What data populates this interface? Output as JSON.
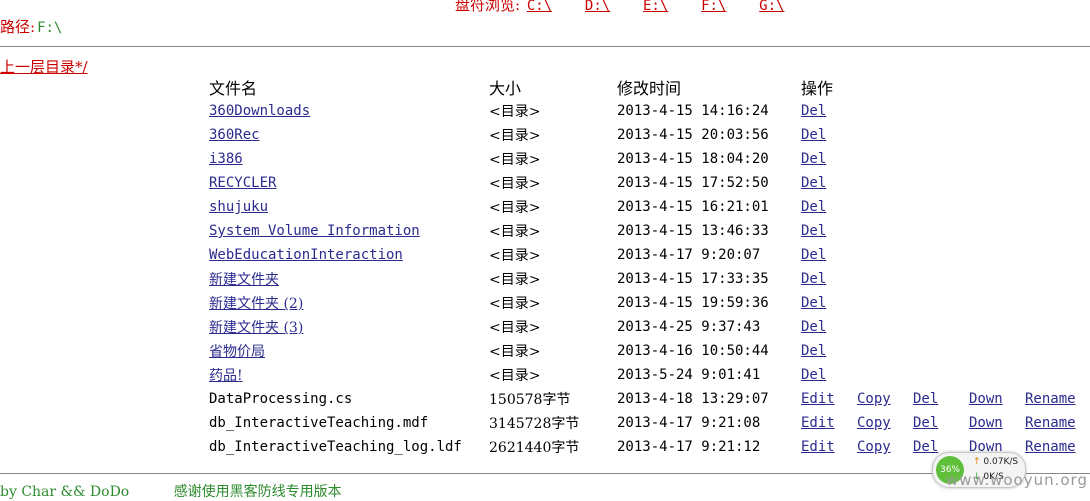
{
  "drives": {
    "label": "盘符浏览:",
    "items": [
      "C:\\",
      "D:\\",
      "E:\\",
      "F:\\",
      "G:\\"
    ]
  },
  "path": {
    "label": "路径:",
    "value": "F:\\"
  },
  "updir": {
    "label": "上一层目录*/"
  },
  "table": {
    "headers": {
      "name": "文件名",
      "size": "大小",
      "time": "修改时间",
      "op": "操作"
    },
    "dirs": [
      {
        "name": "360Downloads",
        "size": "<目录>",
        "time": "2013-4-15 14:16:24",
        "del": "Del"
      },
      {
        "name": "360Rec",
        "size": "<目录>",
        "time": "2013-4-15 20:03:56",
        "del": "Del"
      },
      {
        "name": "i386",
        "size": "<目录>",
        "time": "2013-4-15 18:04:20",
        "del": "Del"
      },
      {
        "name": "RECYCLER",
        "size": "<目录>",
        "time": "2013-4-15 17:52:50",
        "del": "Del"
      },
      {
        "name": "shujuku",
        "size": "<目录>",
        "time": "2013-4-15 16:21:01",
        "del": "Del"
      },
      {
        "name": "System Volume Information",
        "size": "<目录>",
        "time": "2013-4-15 13:46:33",
        "del": "Del"
      },
      {
        "name": "WebEducationInteraction",
        "size": "<目录>",
        "time": "2013-4-17 9:20:07",
        "del": "Del"
      },
      {
        "name": "新建文件夹",
        "size": "<目录>",
        "time": "2013-4-15 17:33:35",
        "del": "Del"
      },
      {
        "name": "新建文件夹 (2)",
        "size": "<目录>",
        "time": "2013-4-15 19:59:36",
        "del": "Del"
      },
      {
        "name": "新建文件夹 (3)",
        "size": "<目录>",
        "time": "2013-4-25 9:37:43",
        "del": "Del"
      },
      {
        "name": "省物价局",
        "size": "<目录>",
        "time": "2013-4-16 10:50:44",
        "del": "Del"
      },
      {
        "name": "药品!",
        "size": "<目录>",
        "time": "2013-5-24 9:01:41",
        "del": "Del"
      }
    ],
    "files": [
      {
        "name": "DataProcessing.cs",
        "size": "150578字节",
        "time": "2013-4-18 13:29:07",
        "edit": "Edit",
        "copy": "Copy",
        "del": "Del",
        "down": "Down",
        "rename": "Rename"
      },
      {
        "name": "db_InteractiveTeaching.mdf",
        "size": "3145728字节",
        "time": "2013-4-17 9:21:08",
        "edit": "Edit",
        "copy": "Copy",
        "del": "Del",
        "down": "Down",
        "rename": "Rename"
      },
      {
        "name": "db_InteractiveTeaching_log.ldf",
        "size": "2621440字节",
        "time": "2013-4-17 9:21:12",
        "edit": "Edit",
        "copy": "Copy",
        "del": "Del",
        "down": "Down",
        "rename": "Rename"
      }
    ]
  },
  "footer": {
    "credit": "by Char && DoDo",
    "note": "感谢使用黑客防线专用版本"
  },
  "net_widget": {
    "percent": "36%",
    "up": "0.07K/S",
    "down": "0K/S"
  },
  "watermark": "www.wooyun.org",
  "colors": {
    "red": "#cc0000",
    "link": "#2b2b8f",
    "green": "#2e8b2e"
  }
}
